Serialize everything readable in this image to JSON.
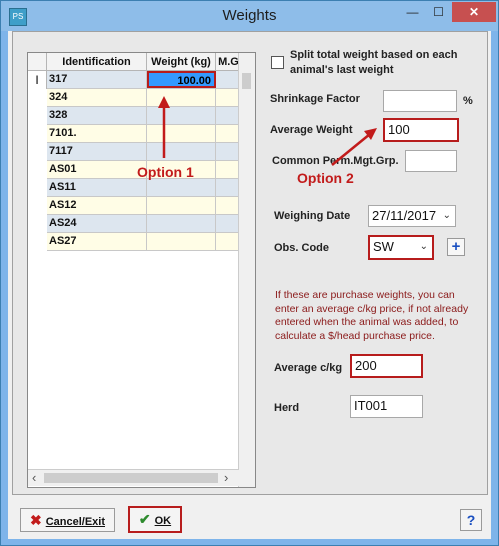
{
  "window": {
    "title": "Weights",
    "app_icon_label": "PS",
    "minimize_glyph": "—",
    "maximize_glyph": "☐",
    "close_glyph": "✕"
  },
  "grid": {
    "columns": [
      "Identification",
      "Weight (kg)",
      "M.Grp."
    ],
    "current_row_marker": "I",
    "rows": [
      {
        "id": "317",
        "weight": "100.00",
        "mgrp": ""
      },
      {
        "id": "324",
        "weight": "",
        "mgrp": ""
      },
      {
        "id": "328",
        "weight": "",
        "mgrp": ""
      },
      {
        "id": "7101.",
        "weight": "",
        "mgrp": ""
      },
      {
        "id": "7117",
        "weight": "",
        "mgrp": ""
      },
      {
        "id": "AS01",
        "weight": "",
        "mgrp": ""
      },
      {
        "id": "AS11",
        "weight": "",
        "mgrp": ""
      },
      {
        "id": "AS12",
        "weight": "",
        "mgrp": ""
      },
      {
        "id": "AS24",
        "weight": "",
        "mgrp": ""
      },
      {
        "id": "AS27",
        "weight": "",
        "mgrp": ""
      }
    ],
    "scroll_left_glyph": "‹",
    "scroll_right_glyph": "›"
  },
  "form": {
    "split_label": "Split total weight based on each animal's last weight",
    "split_checked": false,
    "shrinkage_label": "Shrinkage Factor",
    "shrinkage_value": "",
    "percent_sign": "%",
    "avg_weight_label": "Average Weight",
    "avg_weight_value": "100",
    "common_perm_label": "Common Perm.Mgt.Grp.",
    "common_perm_value": "",
    "weighing_date_label": "Weighing Date",
    "weighing_date_value": "27/11/2017",
    "obs_code_label": "Obs. Code",
    "obs_code_value": "SW",
    "add_glyph": "+",
    "purchase_note": "If these are purchase weights, you can enter an average c/kg price, if not already entered when the animal was added, to calculate a $/head purchase price.",
    "avg_ckg_label": "Average c/kg",
    "avg_ckg_value": "200",
    "herd_label": "Herd",
    "herd_value": "IT001"
  },
  "buttons": {
    "cancel_label": "Cancel/Exit",
    "ok_label": "OK",
    "help_label": "?"
  },
  "annotations": {
    "option1": "Option 1",
    "option2": "Option 2"
  },
  "colors": {
    "highlight_red": "#b71c1c",
    "selection_blue": "#3399ff",
    "note_text": "#8b1a1a"
  }
}
